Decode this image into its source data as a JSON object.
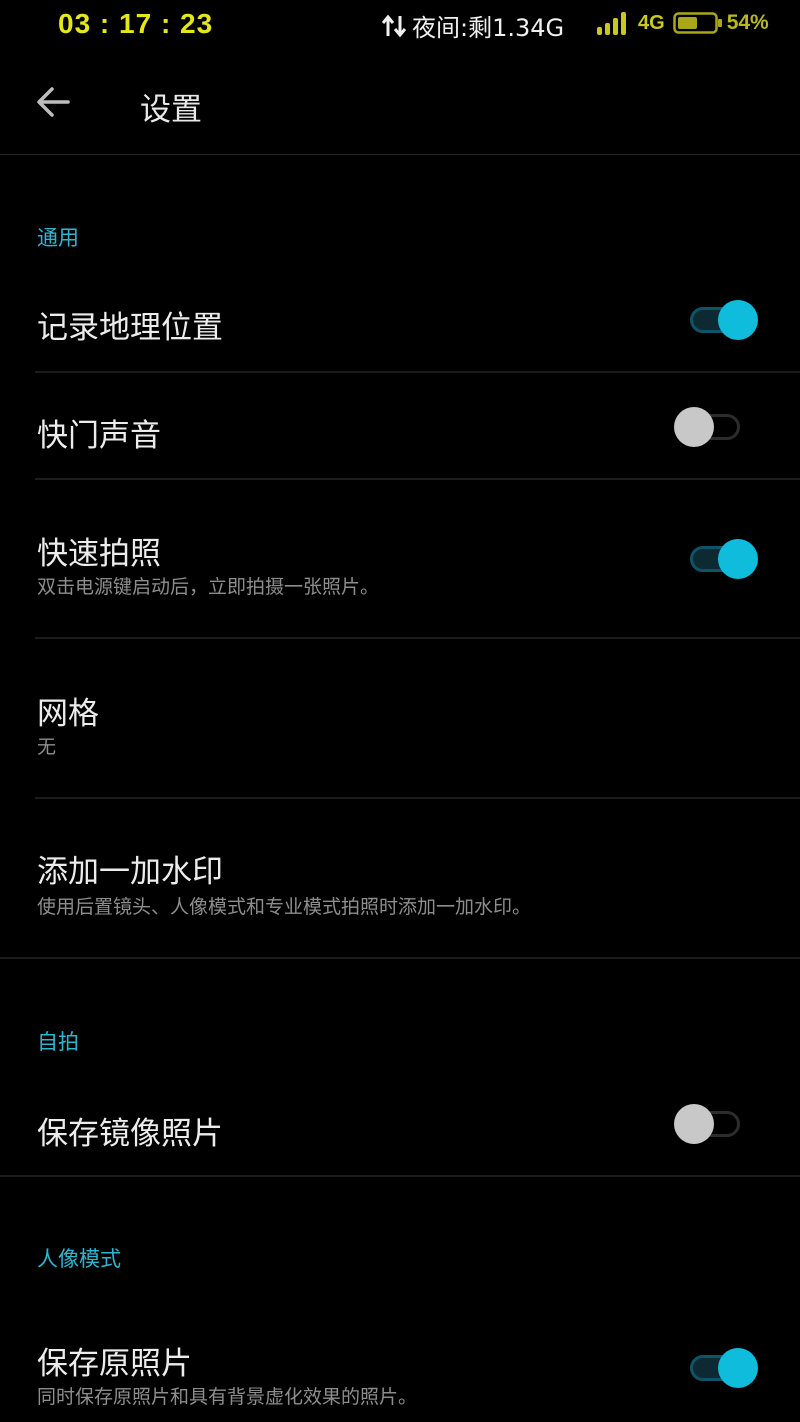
{
  "status_bar": {
    "time": "03 : 17 : 23",
    "night_data": "夜间:剩1.34G",
    "network": "4G",
    "battery": "54%"
  },
  "header": {
    "title": "设置"
  },
  "sections": {
    "general": {
      "label": "通用",
      "location": {
        "title": "记录地理位置",
        "enabled": true
      },
      "shutter_sound": {
        "title": "快门声音",
        "enabled": false
      },
      "quick_capture": {
        "title": "快速拍照",
        "subtitle": "双击电源键启动后，立即拍摄一张照片。",
        "enabled": true
      },
      "grid": {
        "title": "网格",
        "value": "无"
      },
      "watermark": {
        "title": "添加一加水印",
        "subtitle": "使用后置镜头、人像模式和专业模式拍照时添加一加水印。"
      }
    },
    "selfie": {
      "label": "自拍",
      "mirror": {
        "title": "保存镜像照片",
        "enabled": false
      }
    },
    "portrait": {
      "label": "人像模式",
      "save_original": {
        "title": "保存原照片",
        "subtitle": "同时保存原照片和具有背景虚化效果的照片。",
        "enabled": true
      }
    }
  },
  "colors": {
    "accent": "#0fbcdb",
    "section_header": "#2fb6cf",
    "status_time": "#e6e619"
  }
}
